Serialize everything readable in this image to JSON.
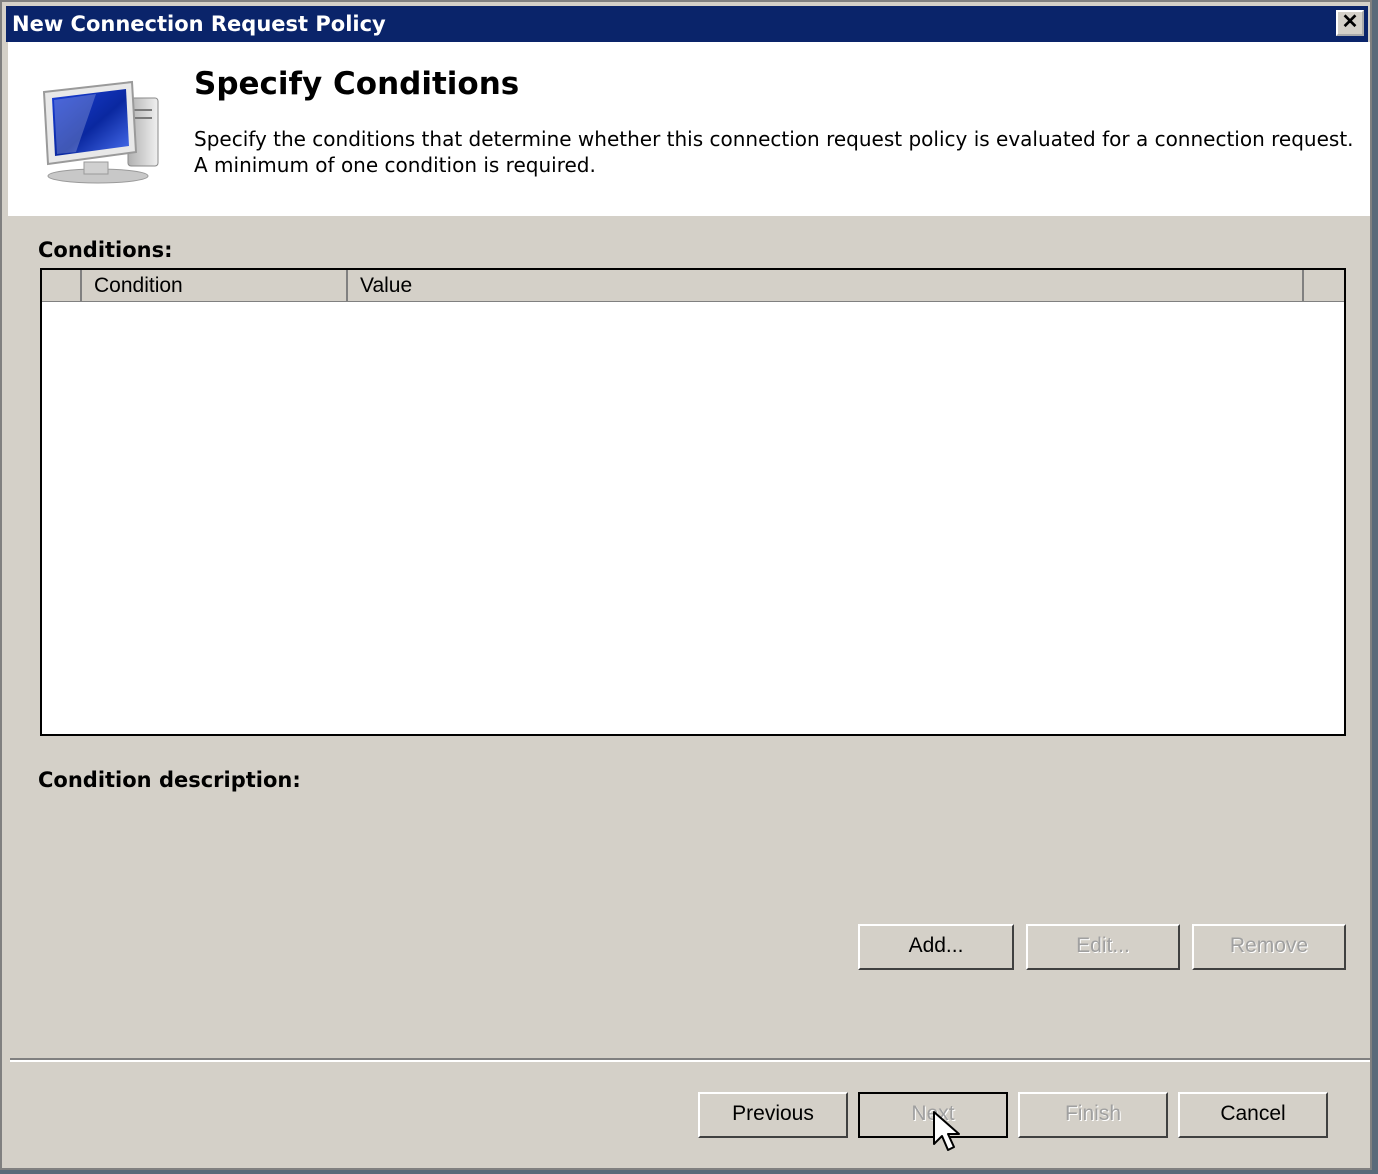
{
  "window": {
    "title": "New Connection Request Policy",
    "close_label": "✕"
  },
  "header": {
    "heading": "Specify Conditions",
    "description_line1": "Specify the conditions that determine whether this connection request policy is evaluated for a connection request.",
    "description_line2": "A minimum of one condition is required.",
    "icon": "computer-monitor-icon"
  },
  "conditions": {
    "label": "Conditions:",
    "columns": [
      "",
      "Condition",
      "Value",
      ""
    ],
    "rows": []
  },
  "condition_description": {
    "label": "Condition description:",
    "text": ""
  },
  "condition_buttons": {
    "add": "Add...",
    "edit": "Edit...",
    "remove": "Remove"
  },
  "wizard_buttons": {
    "previous": "Previous",
    "next": "Next",
    "finish": "Finish",
    "cancel": "Cancel"
  },
  "colors": {
    "titlebar": "#0a246a",
    "dialog_bg": "#d4d0c8",
    "header_bg": "#ffffff",
    "disabled_text": "#a0a0a0"
  }
}
